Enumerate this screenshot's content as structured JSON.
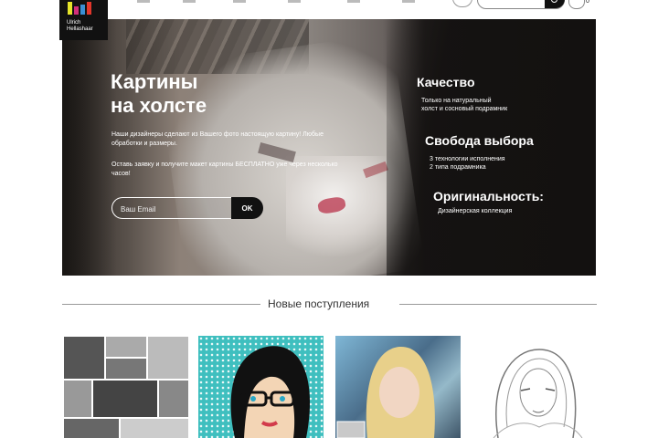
{
  "brand": {
    "logo_lines": "Ulrich\nHellashaar",
    "bar_colors": [
      "#e6e52a",
      "#d22f7a",
      "#3a8fd4",
      "#e3362b"
    ]
  },
  "header": {
    "search_placeholder": "",
    "cart_count": "0"
  },
  "hero": {
    "title_line1": "Картины",
    "title_line2": "на холсте",
    "description": "Наши дизайнеры сделают из Вашего фото настоящую картину! Любые обработки и размеры.",
    "offer": "Оставь заявку и получите макет картины БЕСПЛАТНО уже через несколько часов!",
    "email_placeholder": "Ваш Email",
    "submit_label": "OK"
  },
  "features": [
    {
      "title": "Качество",
      "lines": [
        "Только на натуральный",
        "холст и сосновый подрамник"
      ]
    },
    {
      "title": "Свобода выбора",
      "lines": [
        "3 технологии исполнения",
        "2 типа подрамника"
      ]
    },
    {
      "title": "Оригинальность:",
      "lines": [
        "Дизайнерская коллекция"
      ]
    }
  ],
  "new_arrivals": {
    "title": "Новые поступления"
  },
  "colors": {
    "accent_dark": "#111111",
    "text": "#333333"
  }
}
